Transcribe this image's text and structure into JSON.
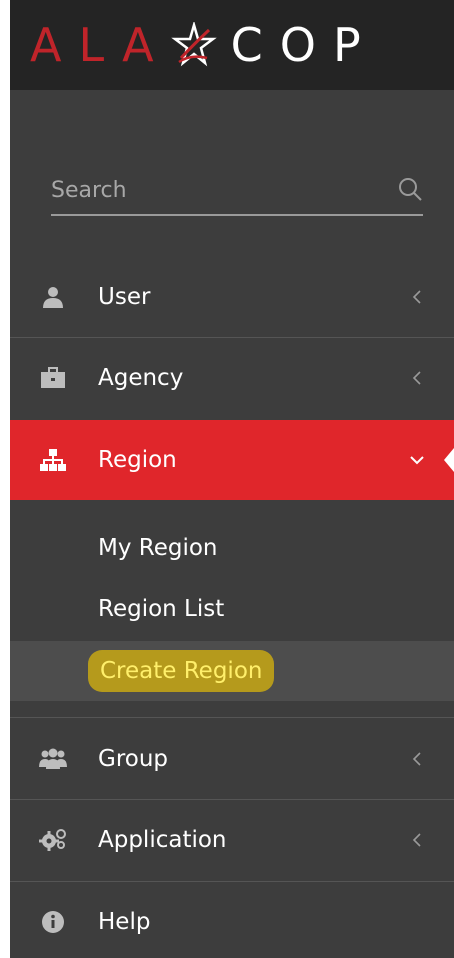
{
  "brand": {
    "logo_red": "ALA",
    "logo_white": "COP",
    "accent_red": "#c0242a",
    "active_red": "#e0262b"
  },
  "search": {
    "placeholder": "Search",
    "icon": "search-icon"
  },
  "menu": {
    "items": [
      {
        "label": "User",
        "icon": "user-icon",
        "chevron": "chevron-left-icon"
      },
      {
        "label": "Agency",
        "icon": "briefcase-icon",
        "chevron": "chevron-left-icon"
      },
      {
        "label": "Region",
        "icon": "sitemap-icon",
        "chevron": "chevron-down-icon",
        "active": true
      },
      {
        "label": "Group",
        "icon": "group-icon",
        "chevron": "chevron-left-icon"
      },
      {
        "label": "Application",
        "icon": "gears-icon",
        "chevron": "chevron-left-icon"
      },
      {
        "label": "Help",
        "icon": "info-icon"
      }
    ],
    "region_submenu": [
      {
        "label": "My Region"
      },
      {
        "label": "Region List"
      },
      {
        "label": "Create Region",
        "highlighted": true
      }
    ]
  }
}
